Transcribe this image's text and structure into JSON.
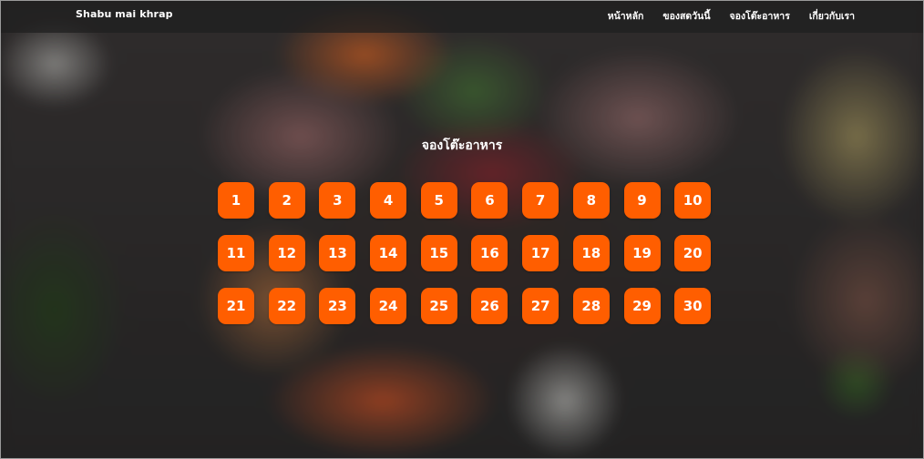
{
  "brand": "Shabu mai khrap",
  "nav": [
    {
      "label": "หน้าหลัก"
    },
    {
      "label": "ของสดวันนี้"
    },
    {
      "label": "จองโต๊ะอาหาร"
    },
    {
      "label": "เกี่ยวกับเรา"
    }
  ],
  "section_title": "จองโต๊ะอาหาร",
  "tables": [
    "1",
    "2",
    "3",
    "4",
    "5",
    "6",
    "7",
    "8",
    "9",
    "10",
    "11",
    "12",
    "13",
    "14",
    "15",
    "16",
    "17",
    "18",
    "19",
    "20",
    "21",
    "22",
    "23",
    "24",
    "25",
    "26",
    "27",
    "28",
    "29",
    "30"
  ],
  "colors": {
    "accent": "#ff5e00",
    "topbar": "#1e1e1e"
  }
}
